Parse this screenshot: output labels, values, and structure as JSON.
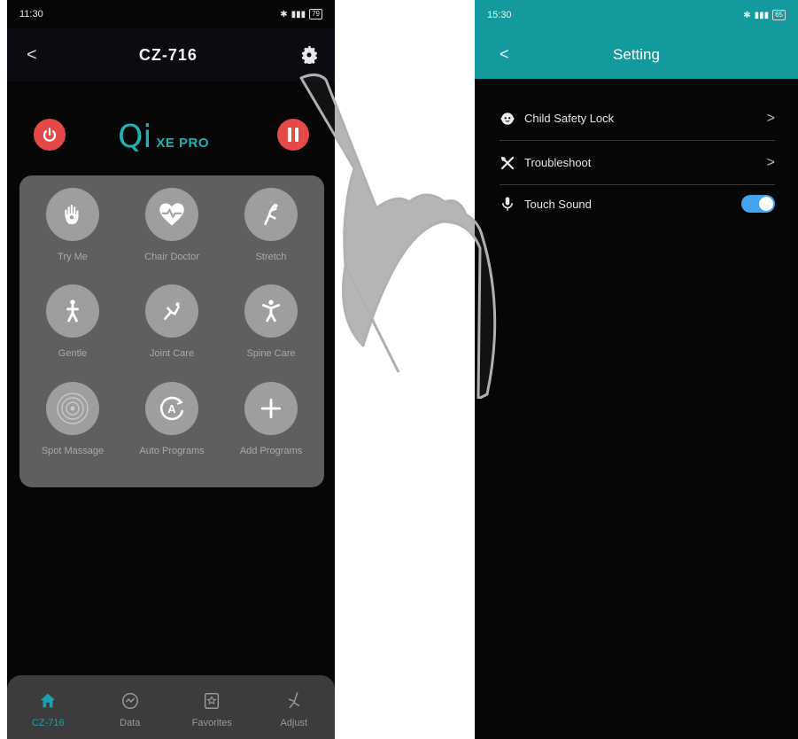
{
  "left": {
    "status": {
      "time": "11:30",
      "battery": "79"
    },
    "appbar": {
      "back": "<",
      "title": "CZ-716"
    },
    "logo": {
      "mark": "Qi",
      "text": "XE PRO"
    },
    "programs": [
      {
        "label": "Try Me",
        "icon": "hand-icon"
      },
      {
        "label": "Chair Doctor",
        "icon": "heart-pulse-icon"
      },
      {
        "label": "Stretch",
        "icon": "stretch-icon"
      },
      {
        "label": "Gentle",
        "icon": "gentle-figure-icon"
      },
      {
        "label": "Joint Care",
        "icon": "joint-care-icon"
      },
      {
        "label": "Spine Care",
        "icon": "spine-care-icon"
      },
      {
        "label": "Spot Massage",
        "icon": "target-icon"
      },
      {
        "label": "Auto Programs",
        "icon": "auto-a-icon"
      },
      {
        "label": "Add Programs",
        "icon": "plus-icon"
      }
    ],
    "nav": [
      {
        "label": "CZ-716",
        "icon": "home-icon",
        "active": true
      },
      {
        "label": "Data",
        "icon": "data-icon",
        "active": false
      },
      {
        "label": "Favorites",
        "icon": "favorites-icon",
        "active": false
      },
      {
        "label": "Adjust",
        "icon": "chair-adjust-icon",
        "active": false
      }
    ]
  },
  "right": {
    "status": {
      "time": "15:30",
      "battery": "65"
    },
    "appbar": {
      "back": "<",
      "title": "Setting"
    },
    "settings": [
      {
        "label": "Child Safety Lock",
        "icon": "child-lock-icon",
        "control": ">"
      },
      {
        "label": "Troubleshoot",
        "icon": "tools-icon",
        "control": ">"
      },
      {
        "label": "Touch Sound",
        "icon": "microphone-icon",
        "control": "toggle",
        "value": true
      }
    ]
  },
  "colors": {
    "accent_teal": "#149a9c",
    "power_red": "#e64a48",
    "toggle_blue": "#43a3ee",
    "nav_active": "#1c9fb0"
  }
}
